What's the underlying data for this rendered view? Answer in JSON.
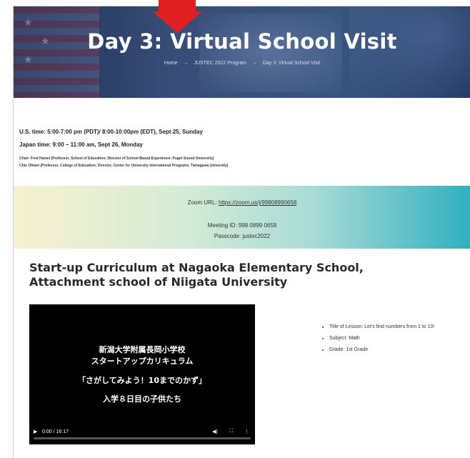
{
  "hero": {
    "title": "Day 3: Virtual School Visit",
    "breadcrumb": [
      "Home",
      "JUSTEC 2022 Program",
      "Day 3: Virtual School Visit"
    ],
    "separator": "→"
  },
  "schedule": {
    "us_time": "U.S. time: 5:00-7:00 pm (PDT)/ 8:00-10:00pm (EDT), Sept 25, Sunday",
    "japan_time": "Japan time: 9:00 – 11:00 am, Sept 26, Monday"
  },
  "chairs": [
    "Chair: Fred Hamel (Professor, School of Education; Director of School-Based Experience; Puget Sound University)",
    "Chie Ohtani (Professor, College of Education; Director, Center for University International Programs; Tamagawa University)"
  ],
  "zoom": {
    "label": "Zoom URL: ",
    "url": "https://zoom.us/j/99808990658",
    "meeting_id": "Meeting ID: 998 0899 0658",
    "passcode": "Passcode: justec2022"
  },
  "section": {
    "title_line1": "Start-up Curriculum at Nagaoka Elementary School,",
    "title_line2": "Attachment school of Niigata University"
  },
  "video": {
    "lines": [
      "新潟大学附属長岡小学校",
      "スタートアップカリキュラム",
      "「さがしてみよう！10までのかず」",
      "入学８日目の子供たち"
    ],
    "time": "0:00 / 16:17"
  },
  "lesson": {
    "items": [
      "Title of Lesson: Let's find numbers from 1 to 10!",
      "Subject: Math",
      "Grade: 1st Grade"
    ]
  },
  "colors": {
    "annotation_arrow": "#e02020",
    "hero_bg": "#1c3464",
    "zoom_gradient_start": "#f6f1cf",
    "zoom_gradient_end": "#2fb0bf"
  }
}
